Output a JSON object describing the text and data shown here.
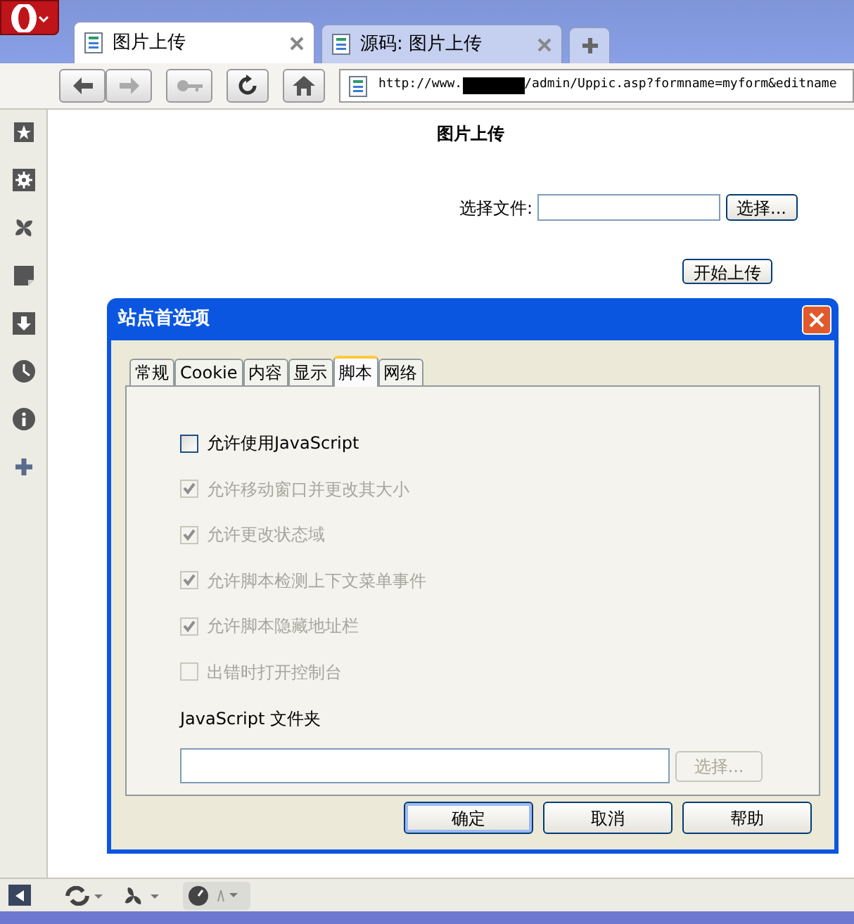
{
  "browser": {
    "tabs": [
      {
        "title": "图片上传",
        "selected": true
      },
      {
        "title": "源码: 图片上传",
        "selected": false
      }
    ],
    "address": {
      "segments": [
        {
          "kind": "text",
          "text": "http://www."
        },
        {
          "kind": "redacted"
        },
        {
          "kind": "text",
          "text": "/admin/Uppic.asp?formname=myform&editname"
        }
      ]
    }
  },
  "page": {
    "title": "图片上传",
    "file_label": "选择文件:",
    "browse_button": "选择...",
    "upload_button": "开始上传"
  },
  "dialog": {
    "title": "站点首选项",
    "tabs": [
      {
        "label": "常规",
        "selected": false
      },
      {
        "label": "Cookie",
        "selected": false
      },
      {
        "label": "内容",
        "selected": false
      },
      {
        "label": "显示",
        "selected": false
      },
      {
        "label": "脚本",
        "selected": true
      },
      {
        "label": "网络",
        "selected": false
      }
    ],
    "options": [
      {
        "label": "允许使用JavaScript",
        "checked": false,
        "disabled": false
      },
      {
        "label": "允许移动窗口并更改其大小",
        "checked": true,
        "disabled": true
      },
      {
        "label": "允许更改状态域",
        "checked": true,
        "disabled": true
      },
      {
        "label": "允许脚本检测上下文菜单事件",
        "checked": true,
        "disabled": true
      },
      {
        "label": "允许脚本隐藏地址栏",
        "checked": true,
        "disabled": true
      },
      {
        "label": "出错时打开控制台",
        "checked": false,
        "disabled": true
      }
    ],
    "folder_label": "JavaScript 文件夹",
    "folder_button": {
      "label": "选择...",
      "disabled": true
    },
    "buttons": [
      "确定",
      "取消",
      "帮助"
    ]
  }
}
